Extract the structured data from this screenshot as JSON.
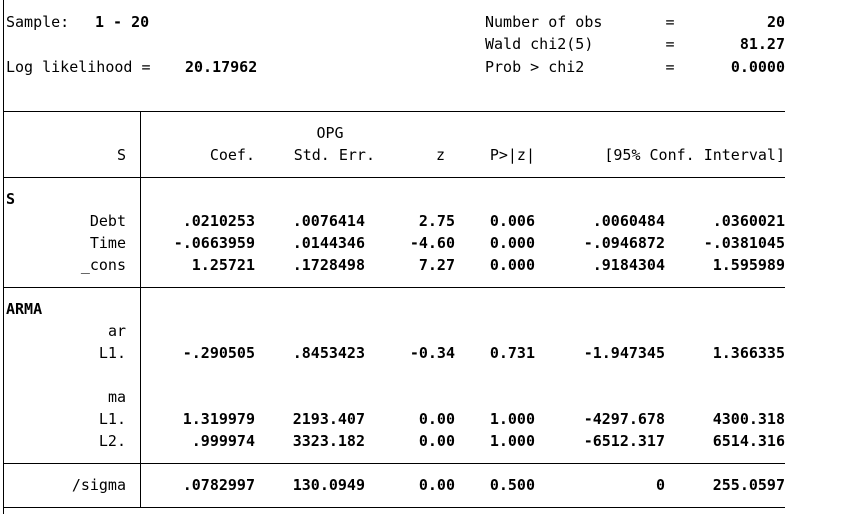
{
  "header": {
    "sample_label": "Sample:",
    "sample_value": "1 - 20",
    "loglik_label": "Log likelihood =",
    "loglik_value": "20.17962",
    "stats": [
      {
        "label": "Number of obs",
        "eq": "=",
        "value": "20"
      },
      {
        "label": "Wald chi2(5)",
        "eq": "=",
        "value": "81.27"
      },
      {
        "label": "Prob > chi2",
        "eq": "=",
        "value": "0.0000"
      }
    ]
  },
  "table": {
    "depvar": "S",
    "col_opg": "OPG",
    "columns": [
      "Coef.",
      "Std. Err.",
      "z",
      "P>|z|",
      "[95% Conf. Interval]"
    ],
    "eq_s": {
      "title": "S",
      "rows": [
        {
          "name": "Debt",
          "coef": ".0210253",
          "se": ".0076414",
          "z": "2.75",
          "p": "0.006",
          "lo": ".0060484",
          "hi": ".0360021"
        },
        {
          "name": "Time",
          "coef": "-.0663959",
          "se": ".0144346",
          "z": "-4.60",
          "p": "0.000",
          "lo": "-.0946872",
          "hi": "-.0381045"
        },
        {
          "name": "_cons",
          "coef": "1.25721",
          "se": ".1728498",
          "z": "7.27",
          "p": "0.000",
          "lo": ".9184304",
          "hi": "1.595989"
        }
      ]
    },
    "eq_arma": {
      "title": "ARMA",
      "ar_label": "ar",
      "ar_rows": [
        {
          "name": "L1.",
          "coef": "-.290505",
          "se": ".8453423",
          "z": "-0.34",
          "p": "0.731",
          "lo": "-1.947345",
          "hi": "1.366335"
        }
      ],
      "ma_label": "ma",
      "ma_rows": [
        {
          "name": "L1.",
          "coef": "1.319979",
          "se": "2193.407",
          "z": "0.00",
          "p": "1.000",
          "lo": "-4297.678",
          "hi": "4300.318"
        },
        {
          "name": "L2.",
          "coef": ".999974",
          "se": "3323.182",
          "z": "0.00",
          "p": "1.000",
          "lo": "-6512.317",
          "hi": "6514.316"
        }
      ]
    },
    "sigma": {
      "name": "/sigma",
      "coef": ".0782997",
      "se": "130.0949",
      "z": "0.00",
      "p": "0.500",
      "lo": "0",
      "hi": "255.0597"
    }
  }
}
